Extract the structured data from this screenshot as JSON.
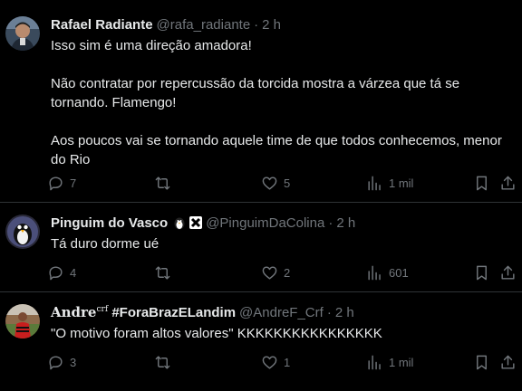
{
  "tweets": [
    {
      "name": "Rafael Radiante",
      "handle": "@rafa_radiante",
      "separator": "·",
      "time": "2 h",
      "text": "Isso sim é uma direção amadora!\n\nNão contratar por repercussão da torcida mostra a várzea que tá se tornando. Flamengo!\n\nAos poucos vai se tornando aquele time de que todos conhecemos, menor do Rio",
      "replies": "7",
      "retweets": "",
      "likes": "5",
      "views": "1 mil"
    },
    {
      "name": "Pinguim do Vasco",
      "handle": "@PinguimDaColina",
      "separator": "·",
      "time": "2 h",
      "badges": [
        "penguin-emoji",
        "vasco-cross-badge"
      ],
      "text": "Tá duro dorme ué",
      "replies": "4",
      "retweets": "",
      "likes": "2",
      "views": "601"
    },
    {
      "name_main": "Andre",
      "name_sup": "crf",
      "name_tag": " #ForaBrazELandim",
      "handle": "@AndreF_Crf",
      "separator": "·",
      "time": "2 h",
      "text": "\"O motivo foram altos valores\" KKKKKKKKKKKKKKKK",
      "replies": "3",
      "retweets": "",
      "likes": "1",
      "views": "1 mil"
    }
  ],
  "icons": {
    "reply": "reply-bubble-icon",
    "retweet": "retweet-icon",
    "like": "heart-icon",
    "views": "bar-chart-icon",
    "bookmark": "bookmark-icon",
    "share": "share-upload-icon"
  },
  "colors": {
    "background": "#000000",
    "text": "#e7e9ea",
    "muted": "#71767b",
    "divider": "#2f3336"
  }
}
